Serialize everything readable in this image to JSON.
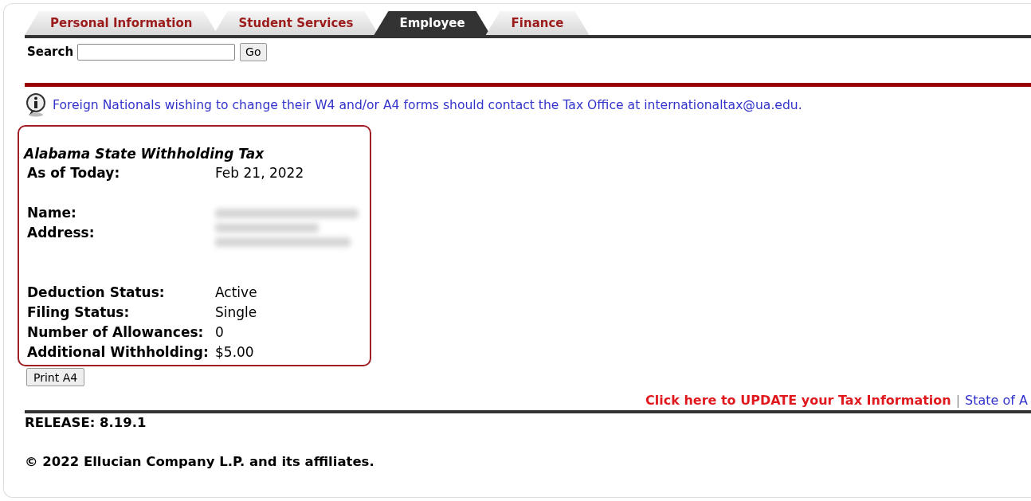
{
  "tabs": [
    {
      "label": "Personal Information",
      "selected": false
    },
    {
      "label": "Student Services",
      "selected": false
    },
    {
      "label": "Employee",
      "selected": true
    },
    {
      "label": "Finance",
      "selected": false
    }
  ],
  "search": {
    "label": "Search",
    "button": "Go"
  },
  "notice": "Foreign Nationals wishing to change their W4 and/or A4 forms should contact the Tax Office at internationaltax@ua.edu.",
  "tax_form": {
    "title": "Alabama State Withholding Tax",
    "sections": [
      [
        {
          "label": "As of Today:",
          "kind": "text",
          "value": "Feb 21, 2022"
        }
      ],
      [
        {
          "label": "Name:",
          "kind": "blurred-line"
        },
        {
          "label": "Address:",
          "kind": "blurred-block"
        }
      ],
      [
        {
          "label": "Deduction Status:",
          "kind": "text",
          "value": "Active"
        },
        {
          "label": "Filing Status:",
          "kind": "text",
          "value": "Single"
        },
        {
          "label": "Number of Allowances:",
          "kind": "text",
          "value": "0"
        },
        {
          "label": "Additional Withholding:",
          "kind": "text",
          "value": "$5.00"
        }
      ]
    ]
  },
  "print_button": "Print A4",
  "links": [
    {
      "text": "Click here to UPDATE your Tax Information",
      "kind": "alert"
    },
    {
      "text": "State of A",
      "kind": "normal"
    }
  ],
  "link_separator": "|",
  "release": "RELEASE: 8.19.1",
  "copyright": "© 2022 Ellucian Company L.P. and its affiliates."
}
